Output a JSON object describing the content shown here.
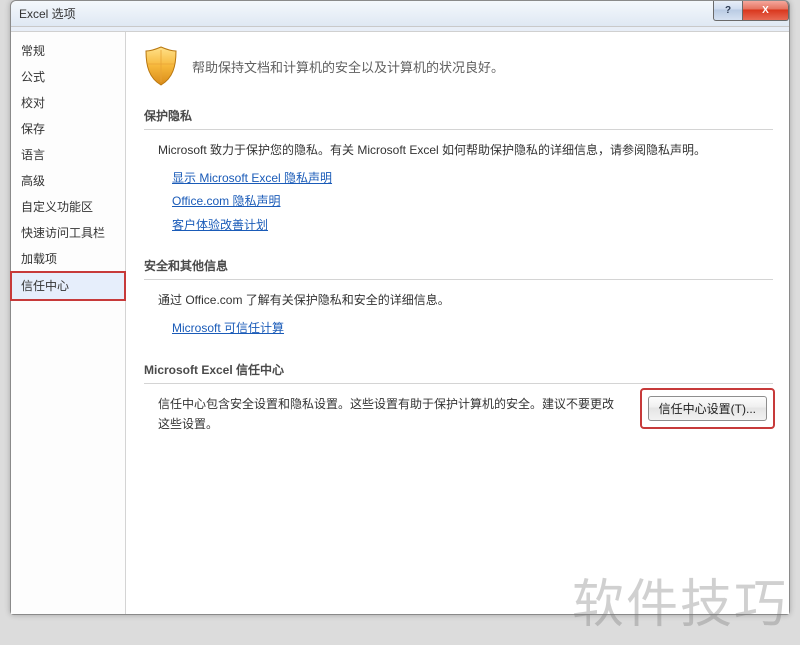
{
  "window": {
    "title": "Excel 选项",
    "help_symbol": "?",
    "close_symbol": "X"
  },
  "sidebar": {
    "items": [
      {
        "label": "常规"
      },
      {
        "label": "公式"
      },
      {
        "label": "校对"
      },
      {
        "label": "保存"
      },
      {
        "label": "语言"
      },
      {
        "label": "高级"
      },
      {
        "label": "自定义功能区"
      },
      {
        "label": "快速访问工具栏"
      },
      {
        "label": "加载项"
      },
      {
        "label": "信任中心"
      }
    ],
    "selected_index": 9
  },
  "content": {
    "hero": "帮助保持文档和计算机的安全以及计算机的状况良好。",
    "privacy": {
      "heading": "保护隐私",
      "intro": "Microsoft 致力于保护您的隐私。有关 Microsoft Excel 如何帮助保护隐私的详细信息，请参阅隐私声明。",
      "links": [
        "显示 Microsoft Excel 隐私声明",
        "Office.com 隐私声明",
        "客户体验改善计划"
      ]
    },
    "security": {
      "heading": "安全和其他信息",
      "intro": "通过 Office.com 了解有关保护隐私和安全的详细信息。",
      "links": [
        "Microsoft 可信任计算"
      ]
    },
    "trust": {
      "heading": "Microsoft Excel 信任中心",
      "desc": "信任中心包含安全设置和隐私设置。这些设置有助于保护计算机的安全。建议不要更改这些设置。",
      "button": "信任中心设置(T)..."
    }
  },
  "watermark": "软件技巧"
}
